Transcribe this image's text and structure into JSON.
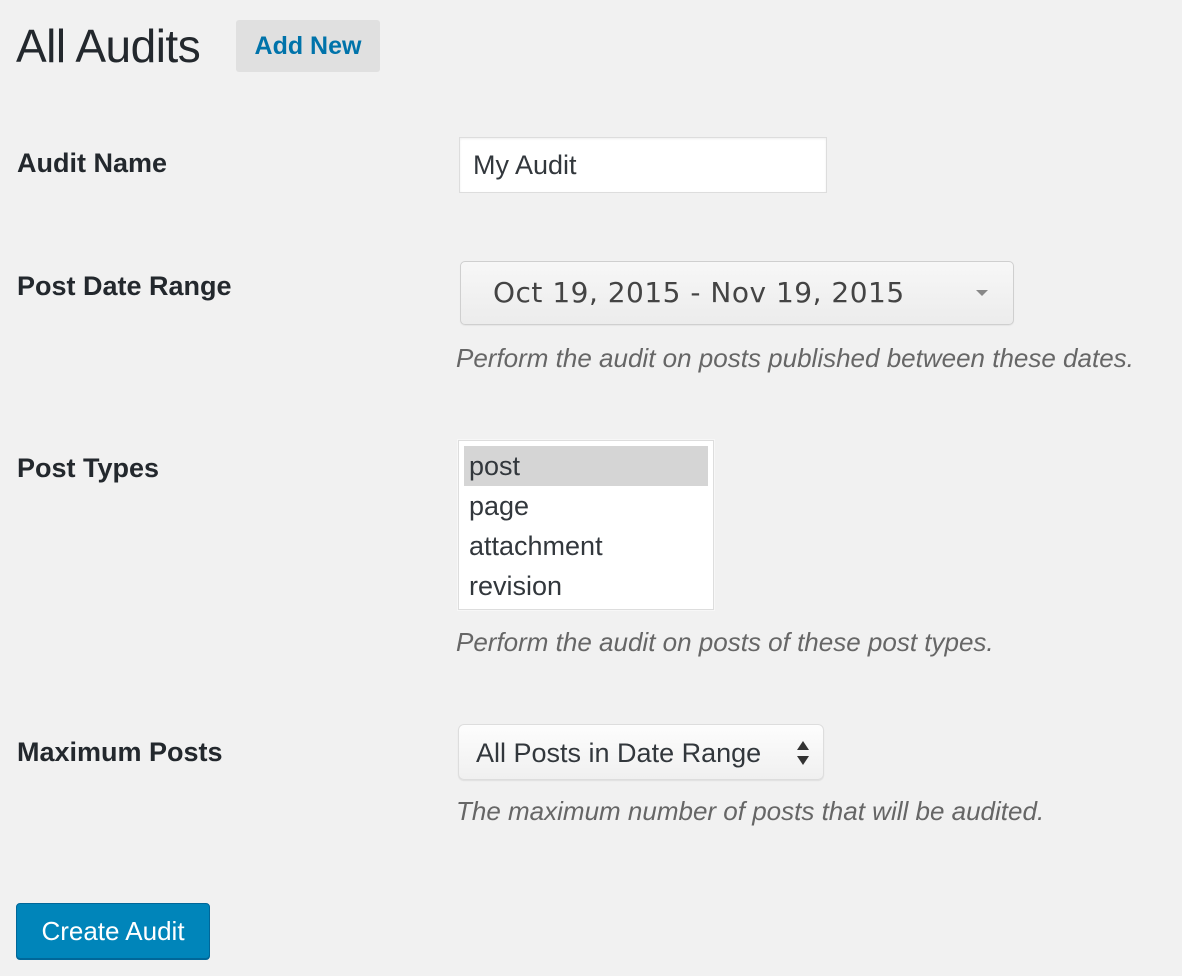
{
  "header": {
    "title": "All Audits",
    "add_new_label": "Add New",
    "accent_color": "#0073aa"
  },
  "form": {
    "audit_name": {
      "label": "Audit Name",
      "value": "My Audit"
    },
    "post_date_range": {
      "label": "Post Date Range",
      "value": "Oct 19, 2015 - Nov 19, 2015",
      "description": "Perform the audit on posts published between these dates.",
      "icon": "caret-down-icon"
    },
    "post_types": {
      "label": "Post Types",
      "options": [
        "post",
        "page",
        "attachment",
        "revision"
      ],
      "selected": "post",
      "description": "Perform the audit on posts of these post types."
    },
    "maximum_posts": {
      "label": "Maximum Posts",
      "value": "All Posts in Date Range",
      "description": "The maximum number of posts that will be audited.",
      "icon": "up-down-arrows-icon"
    },
    "submit": {
      "label": "Create Audit",
      "color": "#0085ba"
    }
  }
}
